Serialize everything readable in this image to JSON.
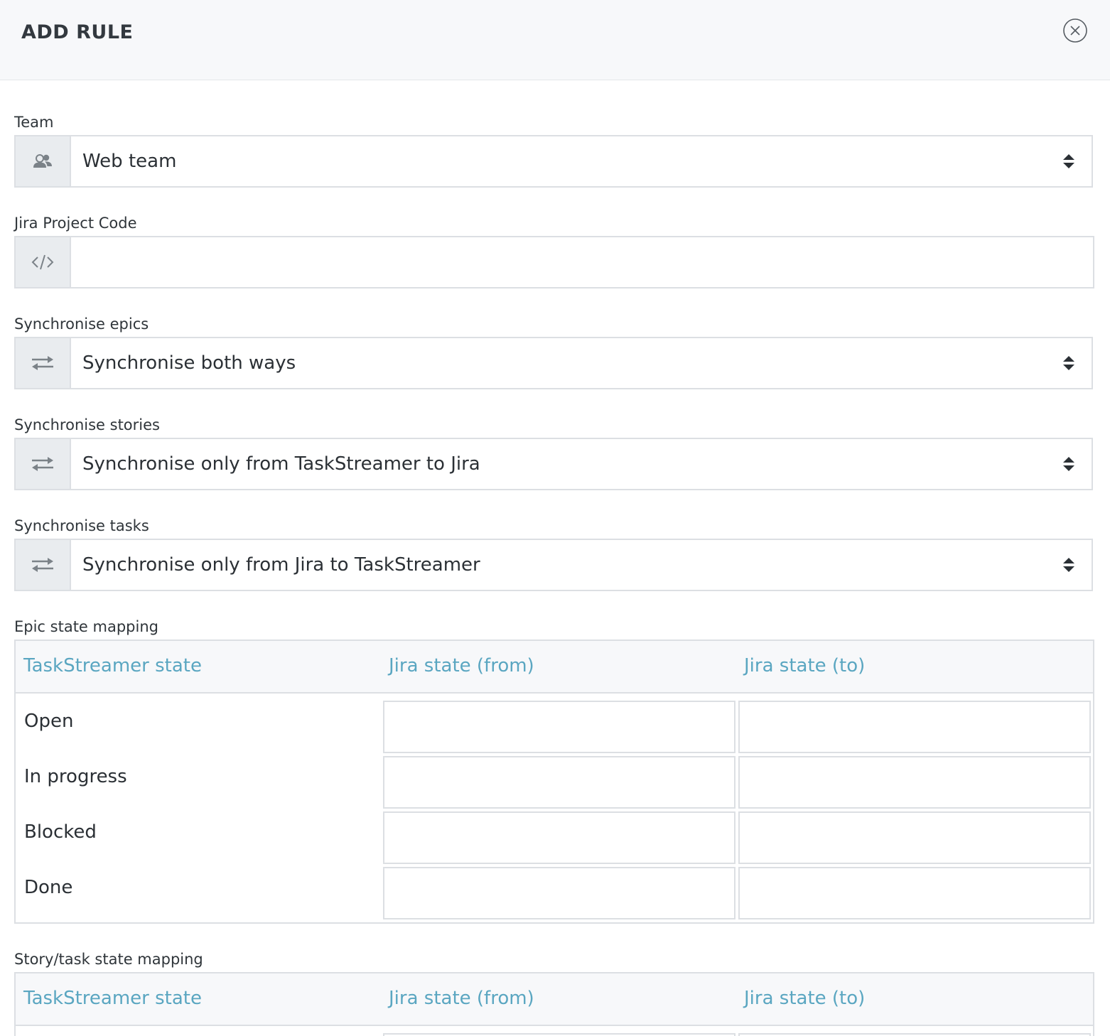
{
  "modal": {
    "title": "ADD RULE",
    "close_icon": "close-circle-icon"
  },
  "team": {
    "label": "Team",
    "icon": "users-icon",
    "value": "Web team"
  },
  "jira_project_code": {
    "label": "Jira Project Code",
    "icon": "code-icon",
    "value": "",
    "placeholder": ""
  },
  "sync_epics": {
    "label": "Synchronise epics",
    "icon": "sync-arrows-icon",
    "value": "Synchronise both ways"
  },
  "sync_stories": {
    "label": "Synchronise stories",
    "icon": "sync-arrows-icon",
    "value": "Synchronise only from TaskStreamer to Jira"
  },
  "sync_tasks": {
    "label": "Synchronise tasks",
    "icon": "sync-arrows-icon",
    "value": "Synchronise only from Jira to TaskStreamer"
  },
  "epic_mapping": {
    "label": "Epic state mapping",
    "headers": [
      "TaskStreamer state",
      "Jira state (from)",
      "Jira state (to)"
    ],
    "rows": [
      {
        "state": "Open",
        "from": "",
        "to": ""
      },
      {
        "state": "In progress",
        "from": "",
        "to": ""
      },
      {
        "state": "Blocked",
        "from": "",
        "to": ""
      },
      {
        "state": "Done",
        "from": "",
        "to": ""
      }
    ]
  },
  "story_task_mapping": {
    "label": "Story/task state mapping",
    "headers": [
      "TaskStreamer state",
      "Jira state (from)",
      "Jira state (to)"
    ]
  },
  "colors": {
    "header_bg": "#f7f8fa",
    "addon_bg": "#e9ecef",
    "border": "#dcdfe3",
    "column_header_text": "#5aa6c1"
  }
}
